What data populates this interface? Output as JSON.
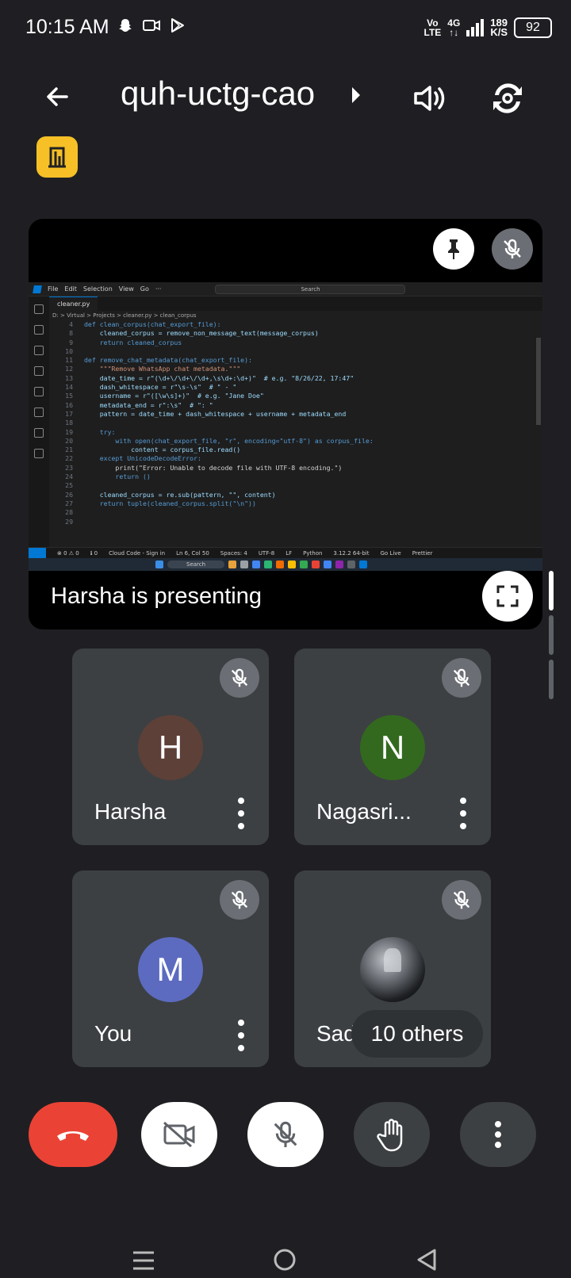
{
  "status_bar": {
    "time": "10:15 AM",
    "network_top": "Vo",
    "network_bottom": "LTE",
    "gen_top": "4G",
    "gen_bottom": "↑↓",
    "speed_value": "189",
    "speed_unit": "K/S",
    "battery": "92",
    "icons": [
      "snapchat-icon",
      "video-camera-icon",
      "play-store-icon"
    ]
  },
  "app_bar": {
    "meeting_code": "quh-uctg-cao"
  },
  "presentation": {
    "label": "Harsha is presenting",
    "shared_screen": {
      "menu": [
        "File",
        "Edit",
        "Selection",
        "View",
        "Go",
        "···"
      ],
      "search_placeholder": "Search",
      "tab": "cleaner.py",
      "breadcrumb": "D: > Virtual > Projects > cleaner.py > clean_corpus",
      "code_lines": [
        {
          "n": "4",
          "t": "def clean_corpus(chat_export_file):"
        },
        {
          "n": "8",
          "t": "    cleaned_corpus = remove_non_message_text(message_corpus)"
        },
        {
          "n": "9",
          "t": "    return cleaned_corpus"
        },
        {
          "n": "10",
          "t": ""
        },
        {
          "n": "11",
          "t": "def remove_chat_metadata(chat_export_file):"
        },
        {
          "n": "12",
          "t": "    \"\"\"Remove WhatsApp chat metadata.\"\"\""
        },
        {
          "n": "13",
          "t": "    date_time = r\"(\\d+\\/\\d+\\/\\d+,\\s\\d+:\\d+)\"  # e.g. \"8/26/22, 17:47\""
        },
        {
          "n": "14",
          "t": "    dash_whitespace = r\"\\s-\\s\"  # \" - \""
        },
        {
          "n": "15",
          "t": "    username = r\"([\\w\\s]+)\"  # e.g. \"Jane Doe\""
        },
        {
          "n": "16",
          "t": "    metadata_end = r\":\\s\"  # \": \""
        },
        {
          "n": "17",
          "t": "    pattern = date_time + dash_whitespace + username + metadata_end"
        },
        {
          "n": "18",
          "t": ""
        },
        {
          "n": "19",
          "t": "    try:"
        },
        {
          "n": "20",
          "t": "        with open(chat_export_file, \"r\", encoding=\"utf-8\") as corpus_file:"
        },
        {
          "n": "21",
          "t": "            content = corpus_file.read()"
        },
        {
          "n": "22",
          "t": "    except UnicodeDecodeError:"
        },
        {
          "n": "23",
          "t": "        print(\"Error: Unable to decode file with UTF-8 encoding.\")"
        },
        {
          "n": "24",
          "t": "        return ()"
        },
        {
          "n": "25",
          "t": ""
        },
        {
          "n": "26",
          "t": "    cleaned_corpus = re.sub(pattern, \"\", content)"
        },
        {
          "n": "27",
          "t": "    return tuple(cleaned_corpus.split(\"\\n\"))"
        },
        {
          "n": "28",
          "t": ""
        },
        {
          "n": "29",
          "t": ""
        }
      ],
      "status_items": [
        "⊗ 0 ⚠ 0",
        "ℹ 0",
        "Cloud Code - Sign in",
        "Ln 6, Col 50",
        "Spaces: 4",
        "UTF-8",
        "LF",
        "Python",
        "3.12.2 64-bit",
        "Go Live",
        "Prettier"
      ],
      "taskbar_search": "Search"
    }
  },
  "participants": [
    {
      "name": "Harsha",
      "initial": "H",
      "avatar_color": "#5d4037"
    },
    {
      "name": "Nagasri...",
      "initial": "N",
      "avatar_color": "#33691e"
    },
    {
      "name": "You",
      "initial": "M",
      "avatar_color": "#5c6bc0"
    },
    {
      "name": "Sadiq",
      "initial": "",
      "avatar_color": "#000000"
    }
  ],
  "others_chip": "10 others",
  "controls": [
    "end-call",
    "camera-off",
    "mic-off",
    "raise-hand",
    "more-options"
  ],
  "colors": {
    "background": "#1f1f23",
    "tile": "#3c4043",
    "hangup": "#ea4335",
    "breakout": "#f6c026"
  }
}
